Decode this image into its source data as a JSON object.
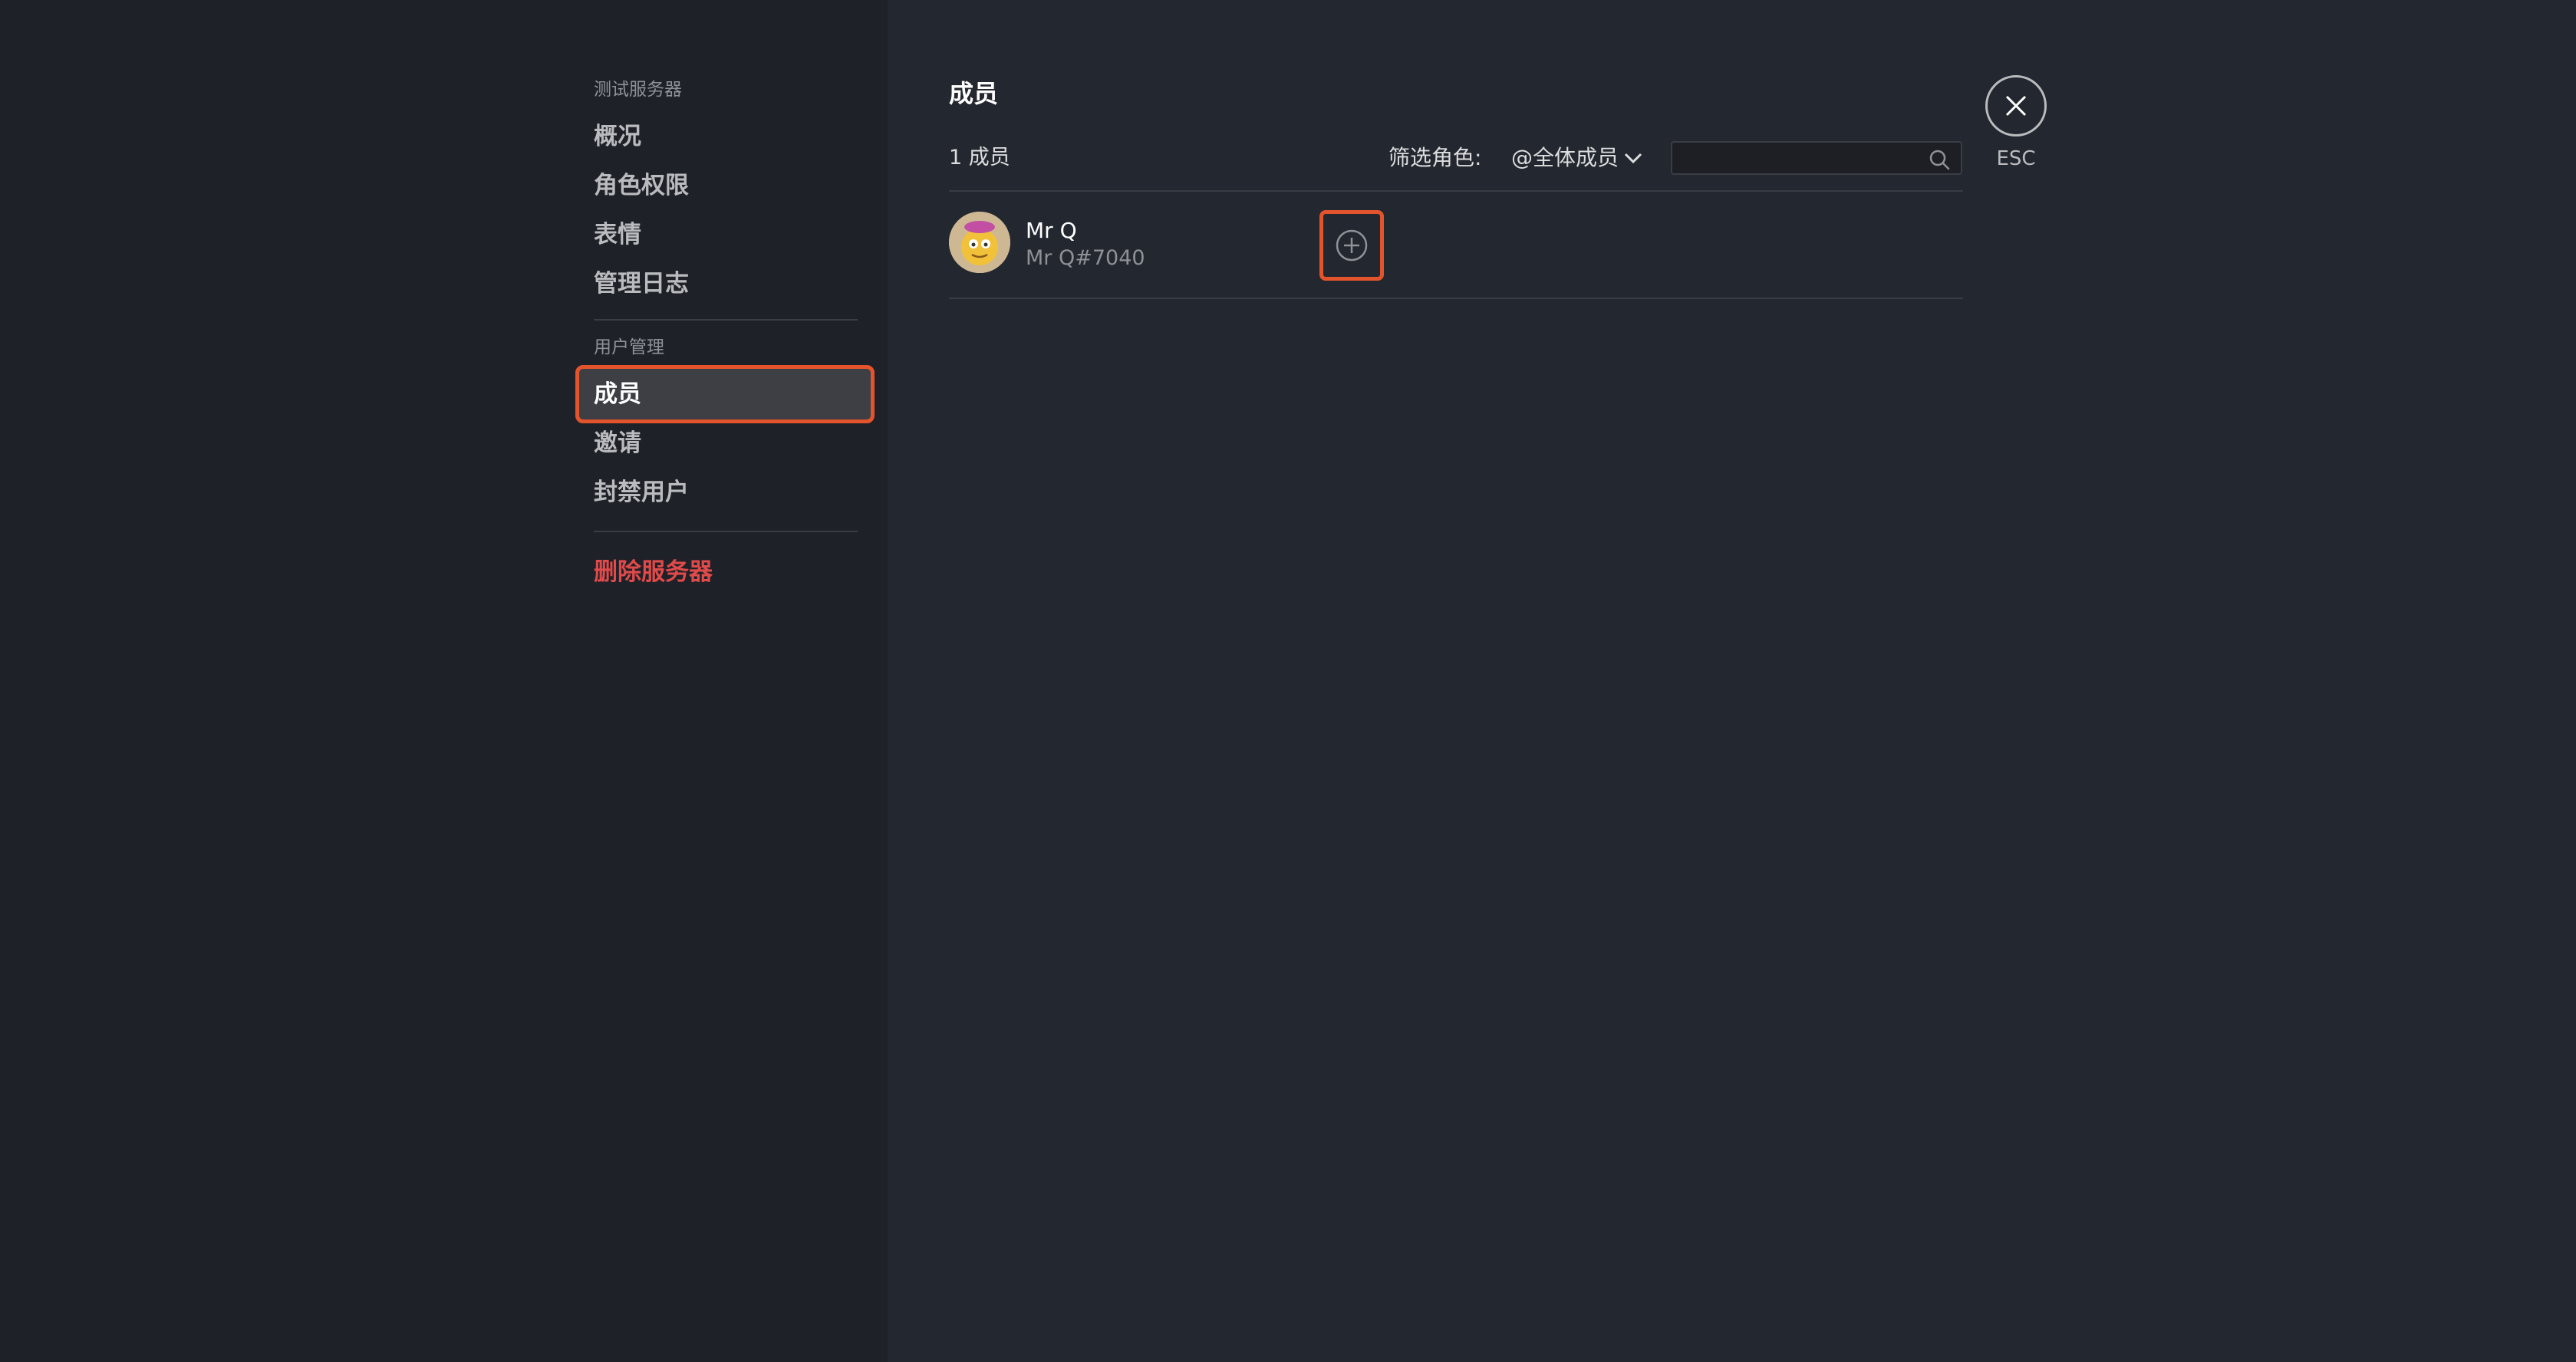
{
  "sidebar": {
    "server_section": "测试服务器",
    "server_items": [
      {
        "label": "概况"
      },
      {
        "label": "角色权限"
      },
      {
        "label": "表情"
      },
      {
        "label": "管理日志"
      }
    ],
    "user_section": "用户管理",
    "user_items": [
      {
        "label": "成员",
        "active": true
      },
      {
        "label": "邀请"
      },
      {
        "label": "封禁用户"
      }
    ],
    "delete_label": "删除服务器"
  },
  "main": {
    "title": "成员",
    "member_count": "1 成员",
    "filter_label": "筛选角色:",
    "role_filter_value": "@全体成员",
    "search": {
      "value": "",
      "placeholder": ""
    },
    "members": [
      {
        "name": "Mr Q",
        "tag": "Mr Q#7040"
      }
    ]
  },
  "close": {
    "esc_label": "ESC"
  },
  "colors": {
    "highlight": "#e4542c",
    "danger": "#e04a4a",
    "sidebar_bg": "#1f2128",
    "main_bg": "#23272f"
  },
  "icons": {
    "close": "close-icon",
    "search": "search-icon",
    "chevron": "chevron-down-icon",
    "add": "plus-circle-icon"
  }
}
